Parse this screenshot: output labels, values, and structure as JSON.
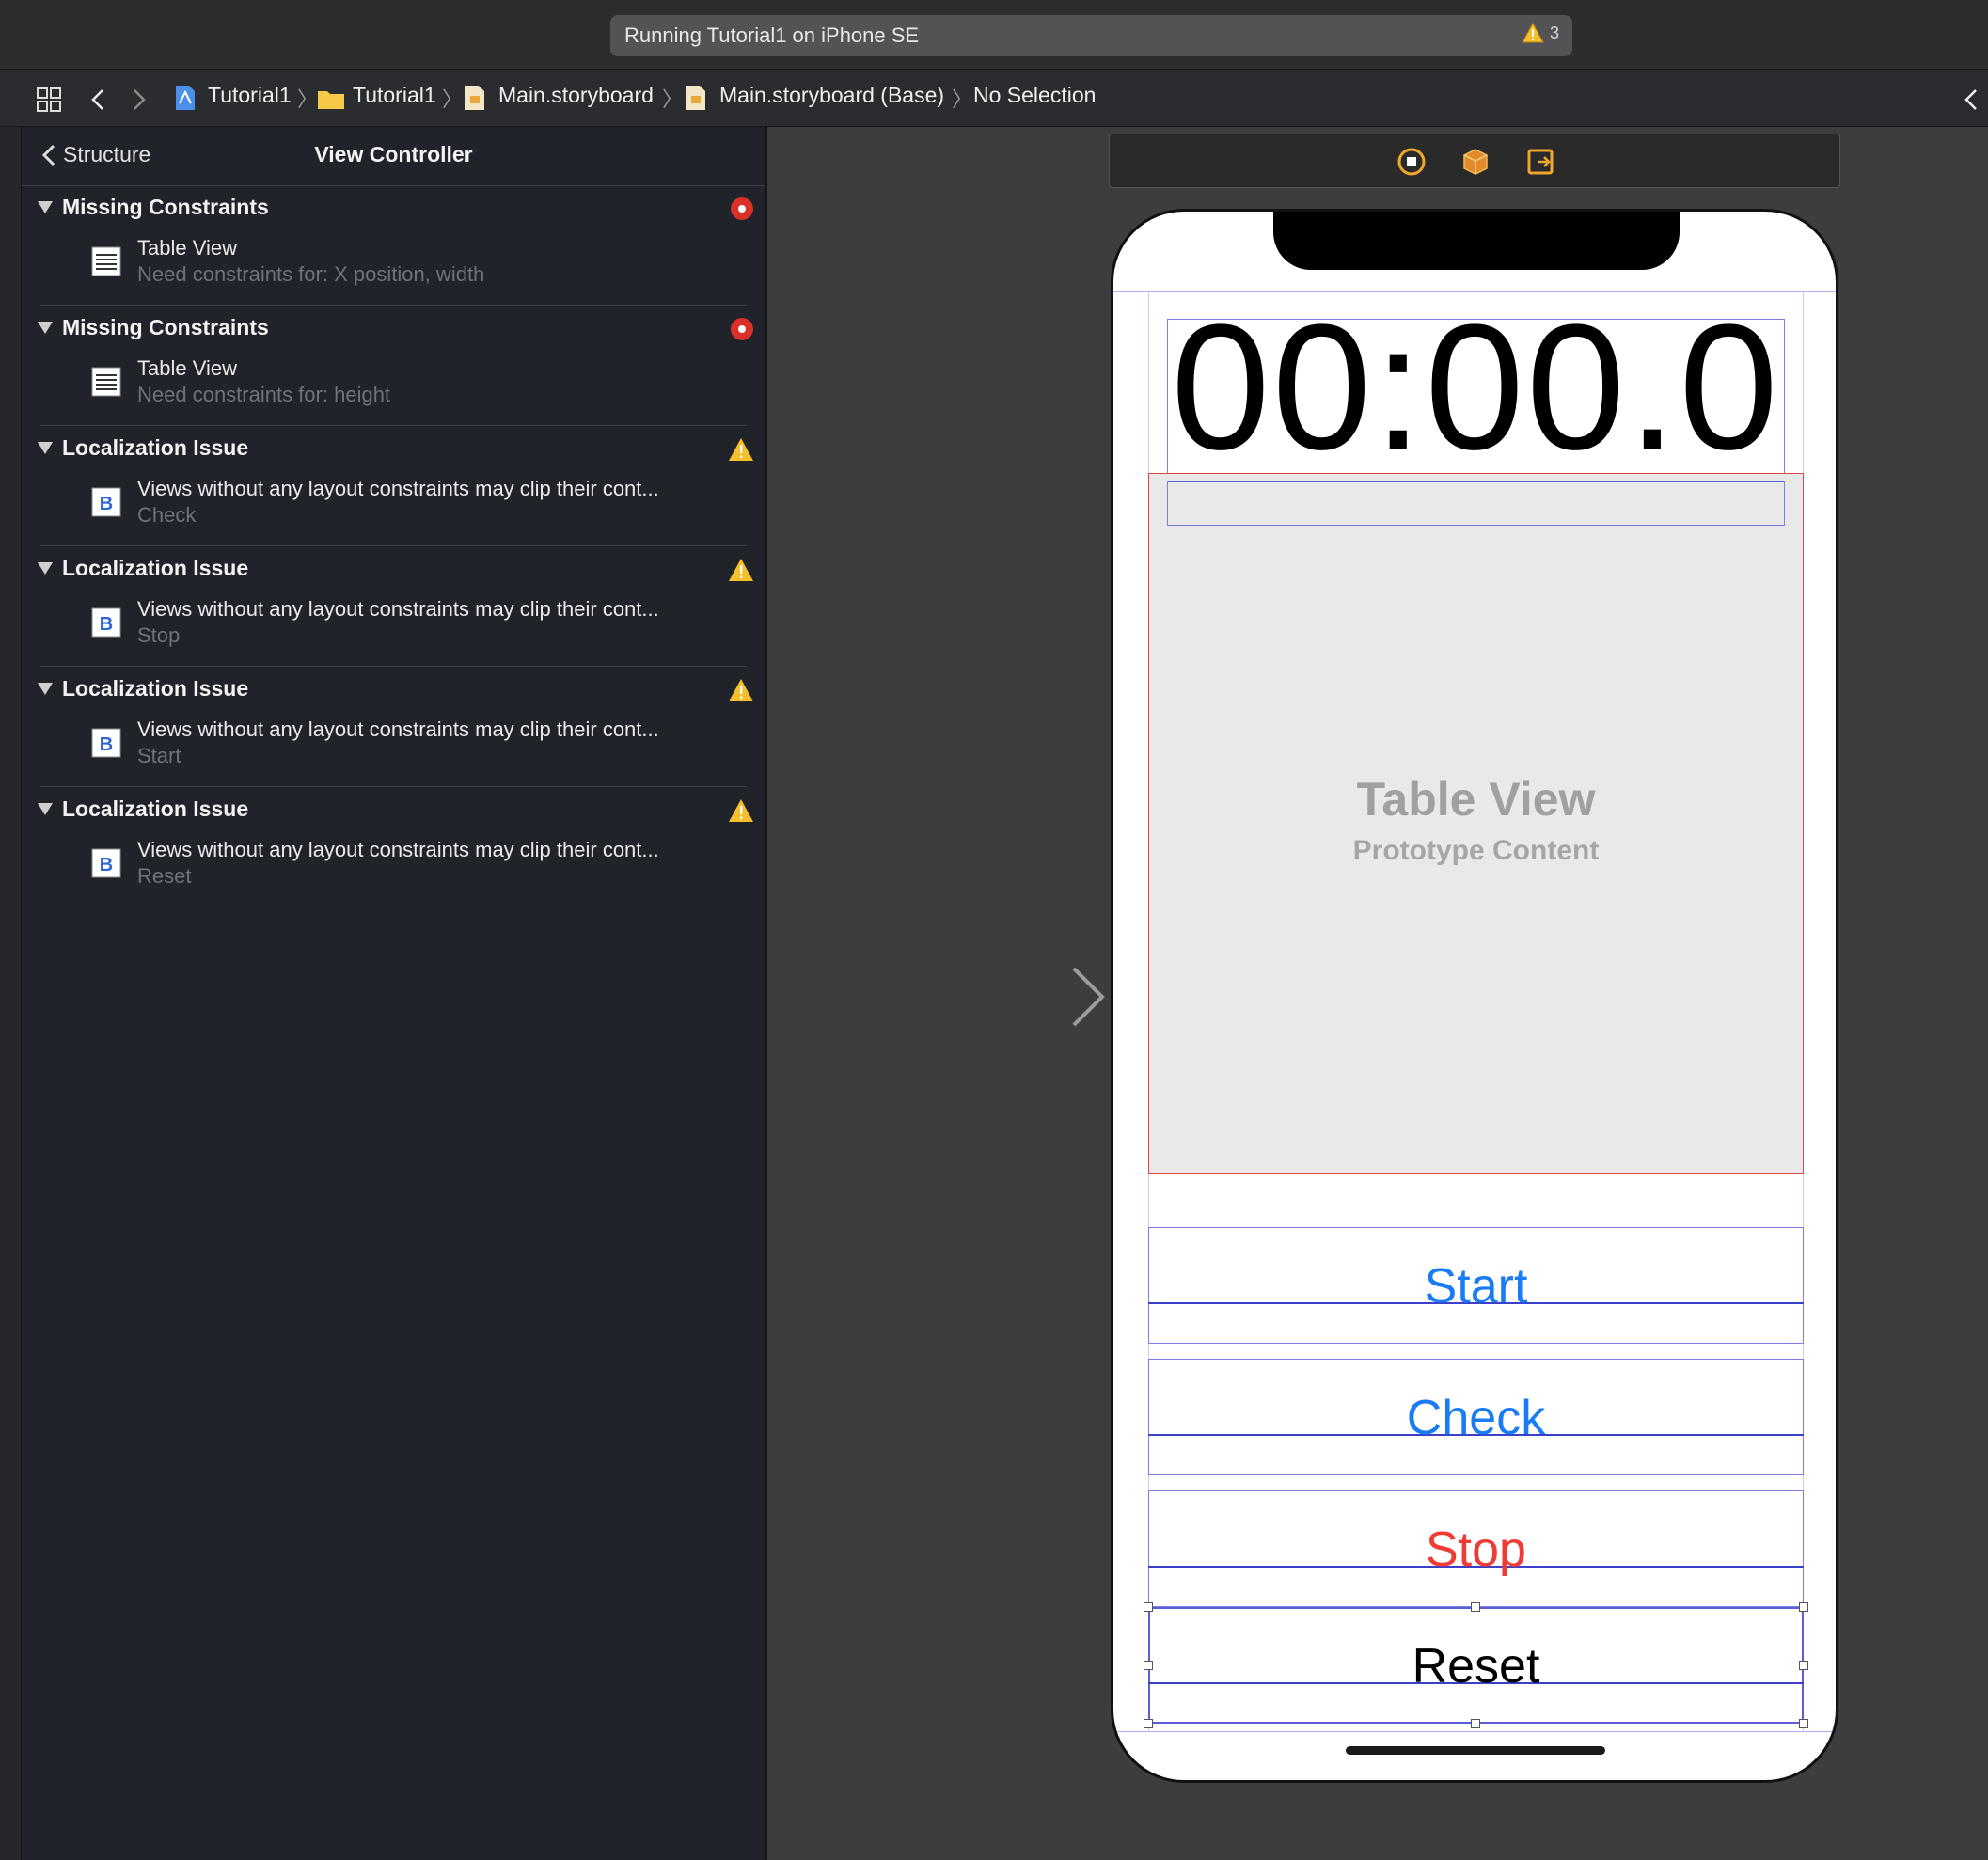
{
  "toolbar": {
    "activity_status": "Running Tutorial1 on iPhone SE",
    "warning_count": "3"
  },
  "jumpbar": {
    "crumbs": [
      "Tutorial1",
      "Tutorial1",
      "Main.storyboard",
      "Main.storyboard (Base)",
      "No Selection"
    ]
  },
  "panel": {
    "back_label": "Structure",
    "title": "View Controller",
    "issues": [
      {
        "group": "Missing Constraints",
        "severity": "error",
        "item": "Table View",
        "detail": "Need constraints for: X position, width",
        "item_icon": "table-view-icon"
      },
      {
        "group": "Missing Constraints",
        "severity": "error",
        "item": "Table View",
        "detail": "Need constraints for: height",
        "item_icon": "table-view-icon"
      },
      {
        "group": "Localization Issue",
        "severity": "warning",
        "item": "Views without any layout constraints may clip their cont...",
        "detail": "Check",
        "item_icon": "button-b-icon"
      },
      {
        "group": "Localization Issue",
        "severity": "warning",
        "item": "Views without any layout constraints may clip their cont...",
        "detail": "Stop",
        "item_icon": "button-b-icon"
      },
      {
        "group": "Localization Issue",
        "severity": "warning",
        "item": "Views without any layout constraints may clip their cont...",
        "detail": "Start",
        "item_icon": "button-b-icon"
      },
      {
        "group": "Localization Issue",
        "severity": "warning",
        "item": "Views without any layout constraints may clip their cont...",
        "detail": "Reset",
        "item_icon": "button-b-icon"
      }
    ]
  },
  "device": {
    "time_label": "00:00.0",
    "table_view_title": "Table View",
    "table_view_subtitle": "Prototype Content",
    "buttons": [
      {
        "label": "Start",
        "color": "#1a7cf5"
      },
      {
        "label": "Check",
        "color": "#1a7cf5"
      },
      {
        "label": "Stop",
        "color": "#ef3b34"
      },
      {
        "label": "Reset",
        "color": "#000000"
      }
    ]
  },
  "colors": {
    "error": "#d9302a",
    "warning": "#f5c02b",
    "selection_blue": "#3a40c7",
    "table_border": "#e04545"
  }
}
